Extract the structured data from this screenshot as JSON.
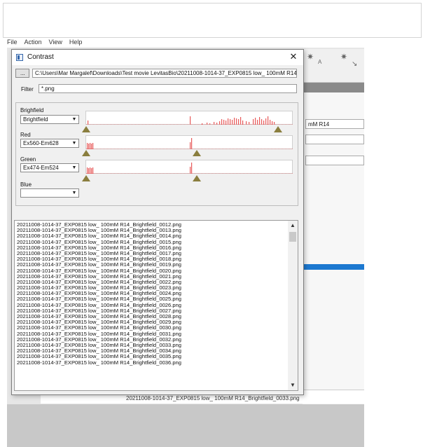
{
  "menu": [
    "File",
    "Action",
    "View",
    "Help"
  ],
  "background": {
    "field1": "mM R14",
    "bottom_file": "20211008-1014-37_EXP0815 low_ 100mM R14_Brightfield_0033.png"
  },
  "dialog": {
    "title": "Contrast",
    "close_glyph": "✕",
    "browse_label": "...",
    "path": "C:\\Users\\Mar Margalef\\Downloads\\Test movie LevitasBio\\20211008-1014-37_EXP0815 low_ 100mM R14",
    "filter_label": "Filter",
    "filter_value": "*.png",
    "channels": [
      {
        "label": "Brighfield",
        "selected": "Brightfield",
        "low": 0.0,
        "high": 0.93
      },
      {
        "label": "Red",
        "selected": "Ex560-Em628",
        "low": 0.0,
        "high": 0.53
      },
      {
        "label": "Green",
        "selected": "Ex474-Em524",
        "low": 0.0,
        "high": 0.53
      },
      {
        "label": "Blue",
        "selected": ""
      }
    ],
    "files": [
      "20211008-1014-37_EXP0815 low_ 100mM R14_Brightfield_0012.png",
      "20211008-1014-37_EXP0815 low_ 100mM R14_Brightfield_0013.png",
      "20211008-1014-37_EXP0815 low_ 100mM R14_Brightfield_0014.png",
      "20211008-1014-37_EXP0815 low_ 100mM R14_Brightfield_0015.png",
      "20211008-1014-37_EXP0815 low_ 100mM R14_Brightfield_0016.png",
      "20211008-1014-37_EXP0815 low_ 100mM R14_Brightfield_0017.png",
      "20211008-1014-37_EXP0815 low_ 100mM R14_Brightfield_0018.png",
      "20211008-1014-37_EXP0815 low_ 100mM R14_Brightfield_0019.png",
      "20211008-1014-37_EXP0815 low_ 100mM R14_Brightfield_0020.png",
      "20211008-1014-37_EXP0815 low_ 100mM R14_Brightfield_0021.png",
      "20211008-1014-37_EXP0815 low_ 100mM R14_Brightfield_0022.png",
      "20211008-1014-37_EXP0815 low_ 100mM R14_Brightfield_0023.png",
      "20211008-1014-37_EXP0815 low_ 100mM R14_Brightfield_0024.png",
      "20211008-1014-37_EXP0815 low_ 100mM R14_Brightfield_0025.png",
      "20211008-1014-37_EXP0815 low_ 100mM R14_Brightfield_0026.png",
      "20211008-1014-37_EXP0815 low_ 100mM R14_Brightfield_0027.png",
      "20211008-1014-37_EXP0815 low_ 100mM R14_Brightfield_0028.png",
      "20211008-1014-37_EXP0815 low_ 100mM R14_Brightfield_0029.png",
      "20211008-1014-37_EXP0815 low_ 100mM R14_Brightfield_0030.png",
      "20211008-1014-37_EXP0815 low_ 100mM R14_Brightfield_0031.png",
      "20211008-1014-37_EXP0815 low_ 100mM R14_Brightfield_0032.png",
      "20211008-1014-37_EXP0815 low_ 100mM R14_Brightfield_0033.png",
      "20211008-1014-37_EXP0815 low_ 100mM R14_Brightfield_0034.png",
      "20211008-1014-37_EXP0815 low_ 100mM R14_Brightfield_0035.png",
      "20211008-1014-37_EXP0815 low_ 100mM R14_Brightfield_0036.png"
    ]
  },
  "colors": {
    "histogram_bar": "#e85a5a",
    "marker": "#8a7e3e",
    "accent_blue": "#1c78d0"
  }
}
